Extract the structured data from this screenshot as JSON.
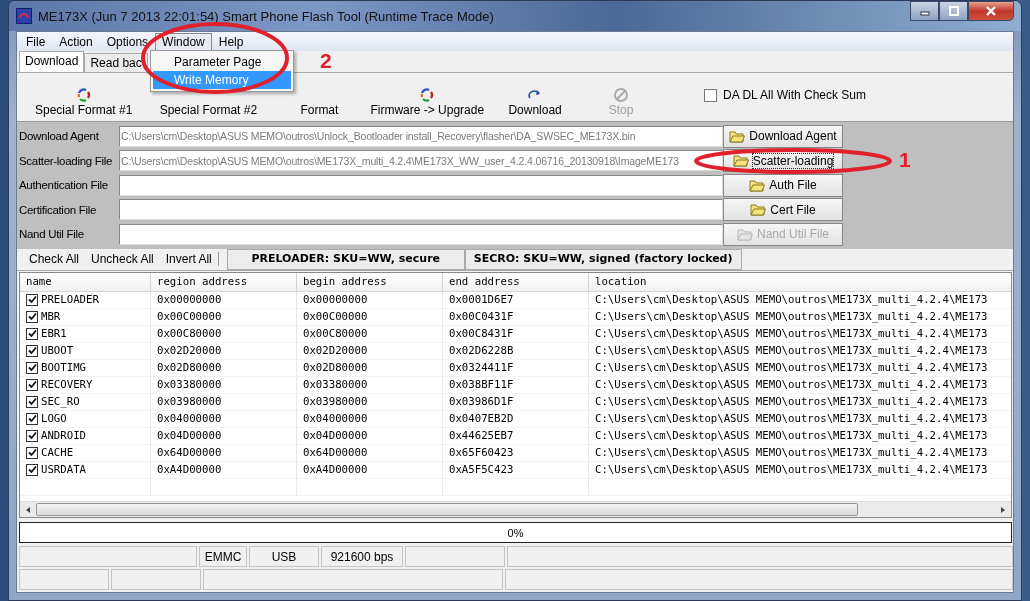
{
  "window": {
    "title": "ME173X (Jun  7 2013 22:01:54) Smart Phone Flash Tool (Runtime Trace Mode)"
  },
  "menu": [
    {
      "label": "File",
      "selected": false
    },
    {
      "label": "Action",
      "selected": false
    },
    {
      "label": "Options",
      "selected": false
    },
    {
      "label": "Window",
      "selected": true
    },
    {
      "label": "Help",
      "selected": false
    }
  ],
  "menu_dropdown": [
    {
      "label": "Parameter Page",
      "selected": false
    },
    {
      "label": "Write Memory",
      "selected": true
    }
  ],
  "tabs": [
    {
      "label": "Download",
      "selected": true
    },
    {
      "label": "Read bac",
      "selected": false
    }
  ],
  "toolbar": [
    {
      "label": "Special Format #1",
      "kind": "cycle",
      "disabled": false
    },
    {
      "label": "Special Format #2",
      "kind": "none",
      "disabled": false
    },
    {
      "label": "Format",
      "kind": "none",
      "disabled": false
    },
    {
      "label": "Firmware -> Upgrade",
      "kind": "cycle",
      "disabled": false
    },
    {
      "label": "Download",
      "kind": "redo",
      "disabled": false
    },
    {
      "label": "Stop",
      "kind": "stop",
      "disabled": true
    }
  ],
  "checksum": {
    "label": "DA DL All With Check Sum",
    "checked": false
  },
  "files": [
    {
      "label": "Download Agent",
      "value": "C:\\Users\\cm\\Desktop\\ASUS MEMO\\outros\\Unlock_Bootloader install_Recovery\\flasher\\DA_SWSEC_ME173X.bin",
      "button": "Download Agent",
      "disabled": false,
      "focused": false
    },
    {
      "label": "Scatter-loading File",
      "value": "C:\\Users\\cm\\Desktop\\ASUS MEMO\\outros\\ME173X_multi_4.2.4\\ME173X_WW_user_4.2.4.06716_20130918\\ImageME173",
      "button": "Scatter-loading",
      "disabled": false,
      "focused": true
    },
    {
      "label": "Authentication File",
      "button": "Auth File",
      "disabled": false,
      "focused": false
    },
    {
      "label": "Certification File",
      "button": "Cert File",
      "disabled": false,
      "focused": false
    },
    {
      "label": "Nand Util File",
      "button": "Nand Util File",
      "disabled": true,
      "focused": false
    }
  ],
  "check_bar": {
    "buttons": [
      "Check All",
      "Uncheck All",
      "Invert All"
    ],
    "info": [
      "PRELOADER: SKU=WW, secure",
      "SECRO: SKU=WW, signed (factory locked)"
    ]
  },
  "table": {
    "columns": [
      "name",
      "region address",
      "begin address",
      "end address",
      "location"
    ],
    "rows": [
      {
        "checked": true,
        "cells": [
          "PRELOADER",
          "0x00000000",
          "0x00000000",
          "0x0001D6E7",
          "C:\\Users\\cm\\Desktop\\ASUS MEMO\\outros\\ME173X_multi_4.2.4\\ME173"
        ]
      },
      {
        "checked": true,
        "cells": [
          "MBR",
          "0x00C00000",
          "0x00C00000",
          "0x00C0431F",
          "C:\\Users\\cm\\Desktop\\ASUS MEMO\\outros\\ME173X_multi_4.2.4\\ME173"
        ]
      },
      {
        "checked": true,
        "cells": [
          "EBR1",
          "0x00C80000",
          "0x00C80000",
          "0x00C8431F",
          "C:\\Users\\cm\\Desktop\\ASUS MEMO\\outros\\ME173X_multi_4.2.4\\ME173"
        ]
      },
      {
        "checked": true,
        "cells": [
          "UBOOT",
          "0x02D20000",
          "0x02D20000",
          "0x02D6228B",
          "C:\\Users\\cm\\Desktop\\ASUS MEMO\\outros\\ME173X_multi_4.2.4\\ME173"
        ]
      },
      {
        "checked": true,
        "cells": [
          "BOOTIMG",
          "0x02D80000",
          "0x02D80000",
          "0x0324411F",
          "C:\\Users\\cm\\Desktop\\ASUS MEMO\\outros\\ME173X_multi_4.2.4\\ME173"
        ]
      },
      {
        "checked": true,
        "cells": [
          "RECOVERY",
          "0x03380000",
          "0x03380000",
          "0x038BF11F",
          "C:\\Users\\cm\\Desktop\\ASUS MEMO\\outros\\ME173X_multi_4.2.4\\ME173"
        ]
      },
      {
        "checked": true,
        "cells": [
          "SEC_RO",
          "0x03980000",
          "0x03980000",
          "0x03986D1F",
          "C:\\Users\\cm\\Desktop\\ASUS MEMO\\outros\\ME173X_multi_4.2.4\\ME173"
        ]
      },
      {
        "checked": true,
        "cells": [
          "LOGO",
          "0x04000000",
          "0x04000000",
          "0x0407EB2D",
          "C:\\Users\\cm\\Desktop\\ASUS MEMO\\outros\\ME173X_multi_4.2.4\\ME173"
        ]
      },
      {
        "checked": true,
        "cells": [
          "ANDROID",
          "0x04D00000",
          "0x04D00000",
          "0x44625EB7",
          "C:\\Users\\cm\\Desktop\\ASUS MEMO\\outros\\ME173X_multi_4.2.4\\ME173"
        ]
      },
      {
        "checked": true,
        "cells": [
          "CACHE",
          "0x64D00000",
          "0x64D00000",
          "0x65F60423",
          "C:\\Users\\cm\\Desktop\\ASUS MEMO\\outros\\ME173X_multi_4.2.4\\ME173"
        ]
      },
      {
        "checked": true,
        "cells": [
          "USRDATA",
          "0xA4D00000",
          "0xA4D00000",
          "0xA5F5C423",
          "C:\\Users\\cm\\Desktop\\ASUS MEMO\\outros\\ME173X_multi_4.2.4\\ME173"
        ]
      }
    ]
  },
  "progress": {
    "label": "0%",
    "level": 0
  },
  "status_bar": [
    {
      "text": "EMMC"
    },
    {
      "text": "USB"
    },
    {
      "text": "921600 bps"
    }
  ],
  "annotations": [
    {
      "number": "2"
    },
    {
      "number": "1"
    }
  ]
}
